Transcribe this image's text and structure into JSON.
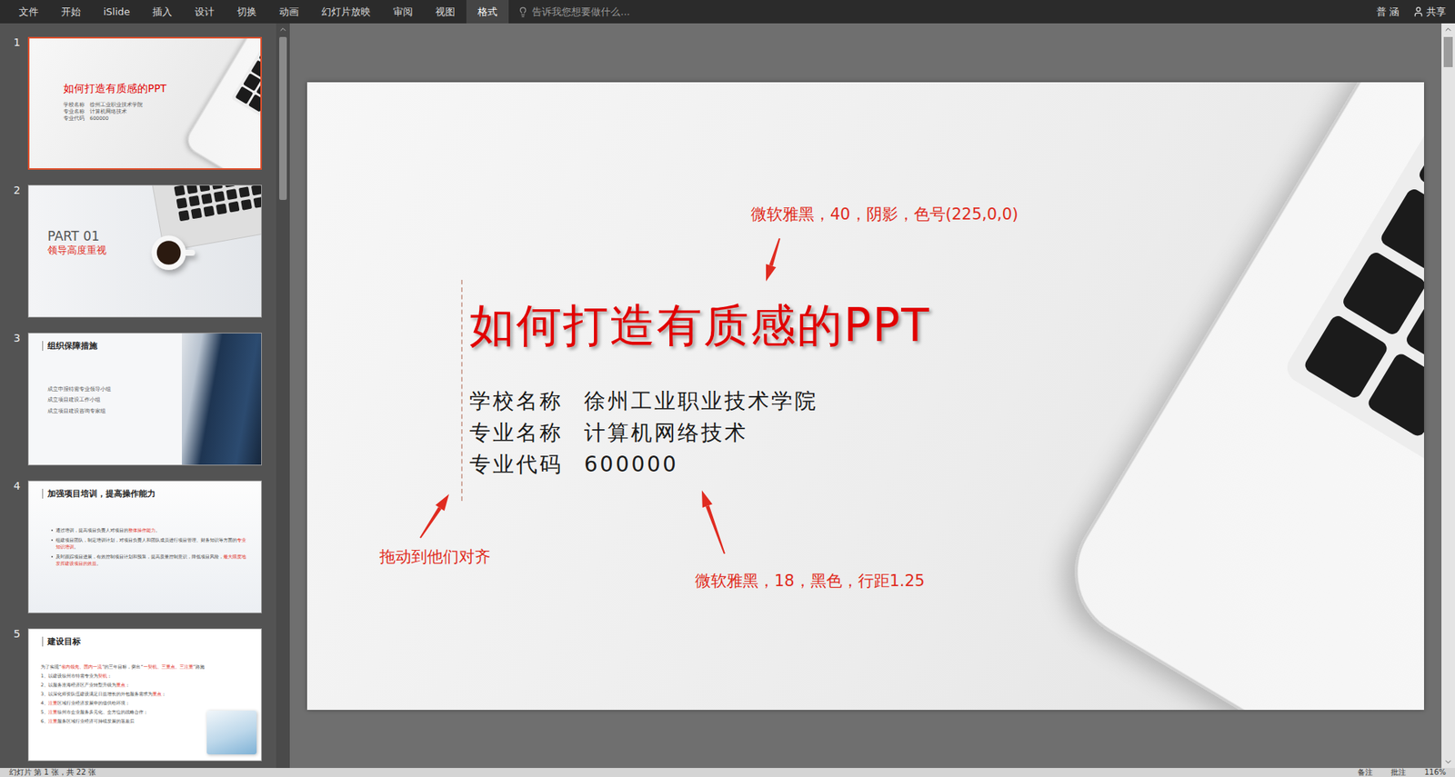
{
  "menu": {
    "tabs": [
      {
        "label": "文件",
        "selected": false
      },
      {
        "label": "开始",
        "selected": false
      },
      {
        "label": "iSlide",
        "selected": false
      },
      {
        "label": "插入",
        "selected": false
      },
      {
        "label": "设计",
        "selected": false
      },
      {
        "label": "切换",
        "selected": false
      },
      {
        "label": "动画",
        "selected": false
      },
      {
        "label": "幻灯片放映",
        "selected": false
      },
      {
        "label": "审阅",
        "selected": false
      },
      {
        "label": "视图",
        "selected": false
      },
      {
        "label": "格式",
        "selected": true
      }
    ],
    "search": {
      "placeholder": "告诉我您想要做什么..."
    },
    "user": "普 涵",
    "share": "共享"
  },
  "thumbnails": [
    {
      "number": "1",
      "selected": true,
      "kind": "title",
      "title": "如何打造有质感的PPT",
      "lines": [
        "学校名称　徐州工业职业技术学院",
        "专业名称　计算机网络技术",
        "专业代码　600000"
      ]
    },
    {
      "number": "2",
      "selected": false,
      "kind": "part",
      "title": "PART 01",
      "subtitle": "领导高度重视"
    },
    {
      "number": "3",
      "selected": false,
      "kind": "list",
      "title": "组织保障措施",
      "lines": [
        "成立申报特需专业领导小组",
        "成立项目建设工作小组",
        "成立项目建设咨询专家组"
      ]
    },
    {
      "number": "4",
      "selected": false,
      "kind": "bullets",
      "title": "加强项目培训，提高操作能力",
      "bullets": [
        [
          {
            "text": "通过培训，提高项目负责人对项目的",
            "highlight": false
          },
          {
            "text": "整体操作能力",
            "highlight": true
          },
          {
            "text": "。",
            "highlight": false
          }
        ],
        [
          {
            "text": "组建项目团队，制定培训计划，对项目负责人和团队成员进行项目管理、财务知识等方面的",
            "highlight": false
          },
          {
            "text": "专业知识培训",
            "highlight": true
          },
          {
            "text": "。",
            "highlight": false
          }
        ],
        [
          {
            "text": "及时跟踪项目进展，有效控制项目计划和预算，提高质量控制意识，降低项目风险，",
            "highlight": false
          },
          {
            "text": "最大限度地发挥建设项目的效益",
            "highlight": true
          },
          {
            "text": "。",
            "highlight": false
          }
        ]
      ]
    },
    {
      "number": "5",
      "selected": false,
      "kind": "numbered",
      "title": "建设目标",
      "intro": [
        {
          "text": "为了实现“",
          "highlight": false
        },
        {
          "text": "省内领先、国内一流",
          "highlight": true
        },
        {
          "text": "”的三年目标，突出“",
          "highlight": false
        },
        {
          "text": "一契机、三重点、三注重",
          "highlight": true
        },
        {
          "text": "”路施",
          "highlight": false
        }
      ],
      "items": [
        [
          {
            "text": "1、以建设徐州市特需专业为",
            "highlight": false
          },
          {
            "text": "契机",
            "highlight": true
          },
          {
            "text": "；",
            "highlight": false
          }
        ],
        [
          {
            "text": "2、以服务淮海经济区产业转型升级为",
            "highlight": false
          },
          {
            "text": "重点",
            "highlight": true
          },
          {
            "text": "；",
            "highlight": false
          }
        ],
        [
          {
            "text": "3、以深化师资队伍建设满足日益增长的外包服务需求为",
            "highlight": false
          },
          {
            "text": "重点",
            "highlight": true
          },
          {
            "text": "；",
            "highlight": false
          }
        ],
        [
          {
            "text": "4、",
            "highlight": false
          },
          {
            "text": "注重",
            "highlight": true
          },
          {
            "text": "区域行业经济发展中的借供给环境；",
            "highlight": false
          }
        ],
        [
          {
            "text": "5、",
            "highlight": false
          },
          {
            "text": "注重",
            "highlight": true
          },
          {
            "text": "徐州市企业服务多元化、全方位的战略合作；",
            "highlight": false
          }
        ],
        [
          {
            "text": "6、",
            "highlight": false
          },
          {
            "text": "注重",
            "highlight": true
          },
          {
            "text": "服务区域行业经济可持续发展的落差后",
            "highlight": false
          }
        ]
      ]
    }
  ],
  "slide": {
    "title": "如何打造有质感的PPT",
    "info": [
      {
        "label": "学校名称",
        "value": "徐州工业职业技术学院"
      },
      {
        "label": "专业名称",
        "value": "计算机网络技术"
      },
      {
        "label": "专业代码",
        "value": "600000"
      }
    ],
    "annotations": [
      "微软雅黑，40，阴影，色号(225,0,0)",
      "拖动到他们对齐",
      "微软雅黑，18，黑色，行距1.25"
    ]
  },
  "status_bar": {
    "slide_info": "幻灯片 第 1 张，共 22 张",
    "notes": "备注",
    "comments": "批注",
    "zoom": "116%"
  }
}
